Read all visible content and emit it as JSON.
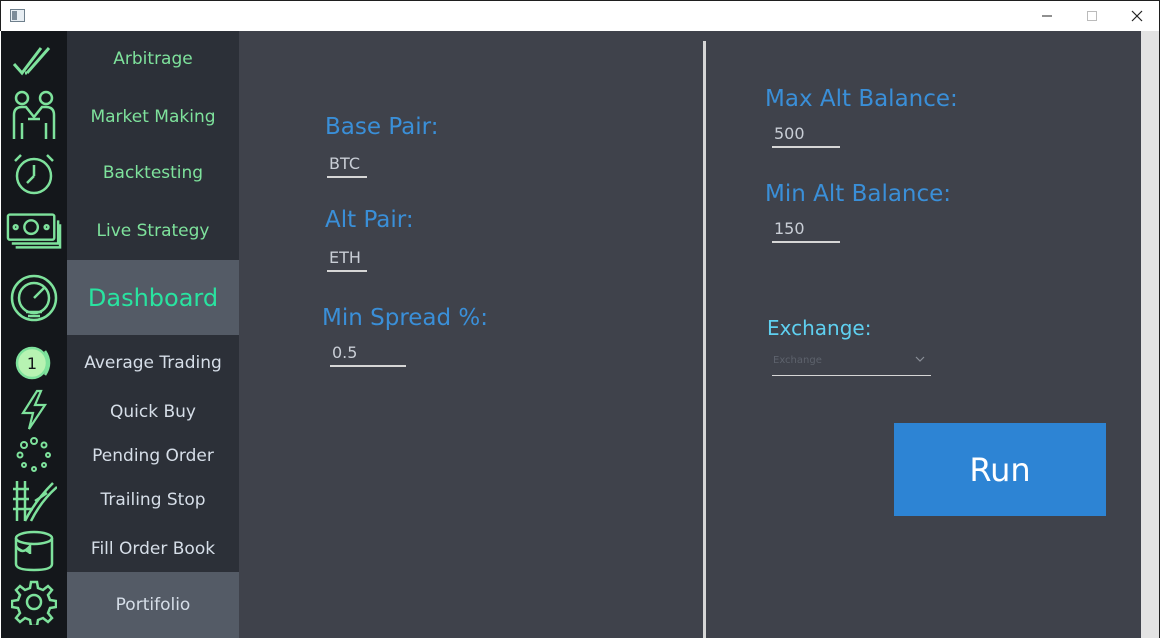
{
  "window": {
    "controls": {
      "minimize": "minimize-icon",
      "maximize": "maximize-icon",
      "close": "close-icon"
    }
  },
  "colors": {
    "accent_green": "#7ee29c",
    "active_teal": "#29e3a0",
    "label_blue": "#3a8fd8",
    "exchange_cyan": "#5fd0f0",
    "run_button": "#2d84d4",
    "main_bg": "#3f424b",
    "nav_bg": "#2c3038",
    "rail_bg": "#14171b"
  },
  "icon_rail": [
    "double-check-icon",
    "handshake-icon",
    "clock-icon",
    "money-icon",
    "speedometer-icon",
    "coin-icon",
    "lightning-icon",
    "spinner-dots-icon",
    "ladder-icon",
    "paint-bucket-icon",
    "gear-icon"
  ],
  "nav": {
    "items": [
      {
        "label": "Arbitrage"
      },
      {
        "label": "Market Making"
      },
      {
        "label": "Backtesting"
      },
      {
        "label": "Live Strategy"
      },
      {
        "label": "Dashboard"
      },
      {
        "label": "Average Trading"
      },
      {
        "label": "Quick Buy"
      },
      {
        "label": "Pending Order"
      },
      {
        "label": "Trailing Stop"
      },
      {
        "label": "Fill Order Book"
      },
      {
        "label": "Portifolio"
      }
    ]
  },
  "form": {
    "base_pair": {
      "label": "Base Pair:",
      "value": "BTC"
    },
    "alt_pair": {
      "label": "Alt Pair:",
      "value": "ETH"
    },
    "min_spread": {
      "label": "Min Spread %:",
      "value": "0.5"
    },
    "max_alt_balance": {
      "label": "Max Alt Balance:",
      "value": "500"
    },
    "min_alt_balance": {
      "label": "Min Alt Balance:",
      "value": "150"
    },
    "exchange": {
      "label": "Exchange:",
      "placeholder": "Exchange"
    },
    "run_label": "Run"
  }
}
